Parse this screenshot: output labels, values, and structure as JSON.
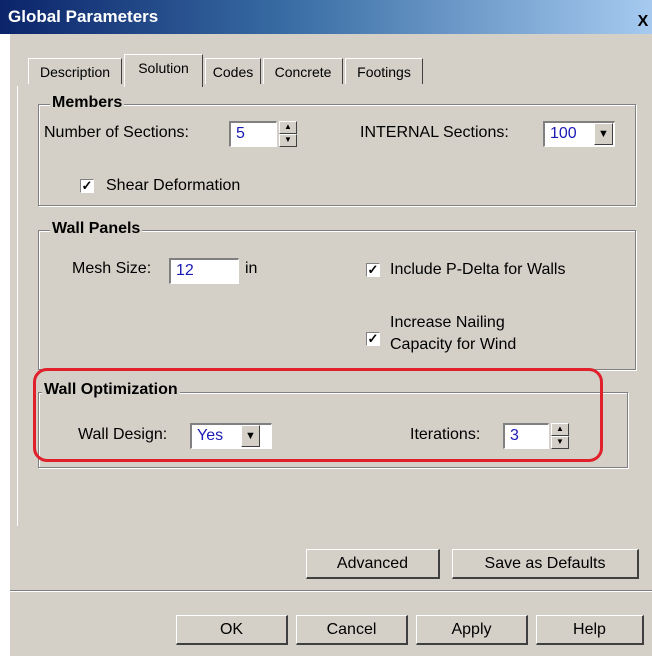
{
  "window": {
    "title": "Global Parameters",
    "close_label": "X"
  },
  "tabs": [
    {
      "label": "Description"
    },
    {
      "label": "Solution"
    },
    {
      "label": "Codes"
    },
    {
      "label": "Concrete"
    },
    {
      "label": "Footings"
    }
  ],
  "members": {
    "title": "Members",
    "num_sections_label": "Number of Sections:",
    "num_sections_value": "5",
    "internal_label": "INTERNAL Sections:",
    "internal_value": "100",
    "shear_label": "Shear Deformation",
    "shear_checked": true
  },
  "wall_panels": {
    "title": "Wall Panels",
    "mesh_label": "Mesh Size:",
    "mesh_value": "12",
    "mesh_unit": "in",
    "pdelta_label": "Include P-Delta for Walls",
    "pdelta_checked": true,
    "nailing_line1": "Increase Nailing",
    "nailing_line2": "Capacity for Wind",
    "nailing_checked": true
  },
  "wall_optimization": {
    "title": "Wall Optimization",
    "design_label": "Wall Design:",
    "design_value": "Yes",
    "iterations_label": "Iterations:",
    "iterations_value": "3"
  },
  "buttons": {
    "advanced": "Advanced",
    "save_defaults": "Save as Defaults",
    "ok": "OK",
    "cancel": "Cancel",
    "apply": "Apply",
    "help": "Help"
  },
  "colors": {
    "highlight": "#e0202a",
    "field_text": "#1a1ab5",
    "dialog_bg": "#d4d0c8"
  }
}
